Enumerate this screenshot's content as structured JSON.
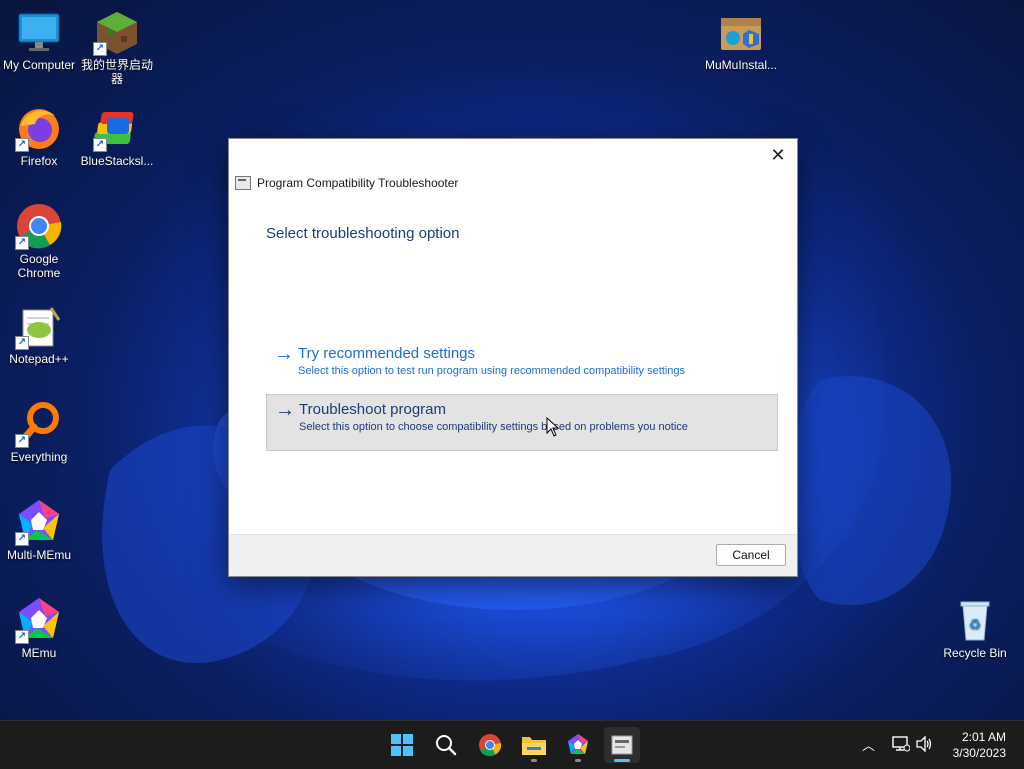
{
  "desktop": {
    "icons": [
      {
        "label": "My Computer"
      },
      {
        "label": "我的世界启动器"
      },
      {
        "label": "MuMuInstal..."
      },
      {
        "label": "Firefox"
      },
      {
        "label": "BlueStacksl..."
      },
      {
        "label": "Google Chrome"
      },
      {
        "label": "Notepad++"
      },
      {
        "label": "Everything"
      },
      {
        "label": "Multi-MEmu"
      },
      {
        "label": "MEmu"
      },
      {
        "label": "Recycle Bin"
      }
    ]
  },
  "dialog": {
    "title": "Program Compatibility Troubleshooter",
    "heading": "Select troubleshooting option",
    "options": [
      {
        "title": "Try recommended settings",
        "description": "Select this option to test run program using recommended compatibility settings"
      },
      {
        "title": "Troubleshoot program",
        "description": "Select this option to choose compatibility settings based on problems you notice"
      }
    ],
    "cancel_label": "Cancel",
    "close_glyph": "✕"
  },
  "taskbar": {
    "apps": [
      "start",
      "search",
      "chrome",
      "file-explorer",
      "memu",
      "troubleshooter"
    ],
    "tray_chevron": "︿",
    "time": "2:01 AM",
    "date": "3/30/2023"
  },
  "colors": {
    "accent": "#1e6bd0",
    "heading": "#1e3a78",
    "taskbar": "#1c1c1c"
  }
}
